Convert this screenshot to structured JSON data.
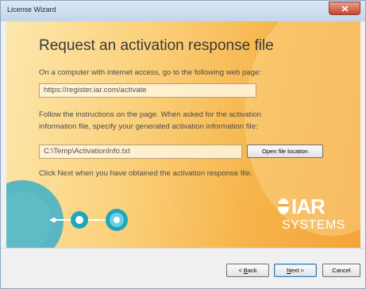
{
  "window": {
    "title": "License Wizard"
  },
  "content": {
    "heading": "Request an activation response file",
    "instruction1": "On a computer with internet access, go to the following web page:",
    "url_value": "https://register.iar.com/activate",
    "instruction2_line1": "Follow the instructions on the page. When asked for the activation",
    "instruction2_line2": "information file, specify your generated activation information file:",
    "file_value": "C:\\Temp\\ActivationInfo.txt",
    "open_location_label": "Open file location",
    "instruction3": "Click Next when you have obtained the activation response file."
  },
  "logo": {
    "brand": "IAR",
    "sub": "SYSTEMS"
  },
  "footer": {
    "back_prefix": "< ",
    "back_key": "B",
    "back_rest": "ack",
    "next_key": "N",
    "next_rest": "ext >",
    "cancel": "Cancel"
  },
  "colors": {
    "accent_orange": "#f3a43a",
    "logo_white": "#ffffff",
    "teal": "#3fb1c4"
  }
}
